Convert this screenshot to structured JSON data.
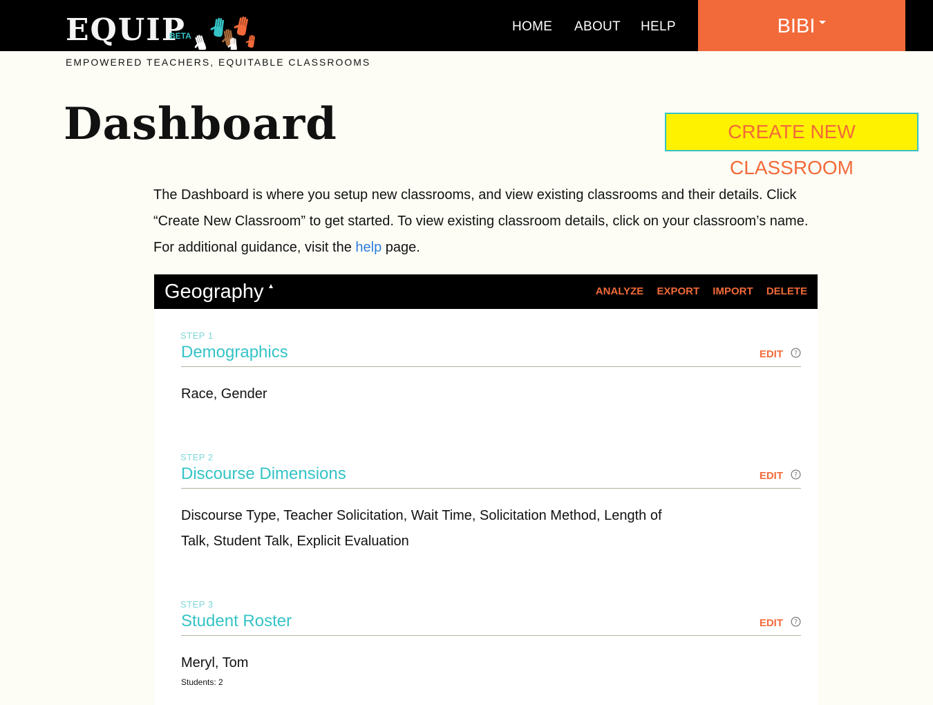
{
  "brand": {
    "name": "EQUIP",
    "badge": "BETA",
    "tagline": "EMPOWERED TEACHERS, EQUITABLE CLASSROOMS",
    "hand_colors": [
      "#ffffff",
      "#35c3c6",
      "#a86a3a",
      "#f26a3a",
      "#ffffff",
      "#f26a3a"
    ]
  },
  "nav": {
    "items": [
      "HOME",
      "ABOUT",
      "HELP"
    ],
    "user": "BIBI"
  },
  "page": {
    "title": "Dashboard",
    "create_button": "CREATE NEW CLASSROOM",
    "intro_before": "The Dashboard is where you setup new classrooms, and view existing classrooms and their details. Click “Create New Classroom” to get started. To view existing classroom details, click on your classroom’s name. For additional guidance, visit the",
    "intro_link": "help",
    "intro_after": "page."
  },
  "classroom": {
    "name": "Geography",
    "actions": [
      "ANALYZE",
      "EXPORT",
      "IMPORT",
      "DELETE"
    ],
    "edit_label": "EDIT",
    "steps": [
      {
        "label": "STEP 1",
        "title": "Demographics",
        "content": "Race, Gender"
      },
      {
        "label": "STEP 2",
        "title": "Discourse Dimensions",
        "content": "Discourse Type, Teacher Solicitation, Wait Time, Solicitation Method, Length of Talk, Student Talk, Explicit Evaluation"
      },
      {
        "label": "STEP 3",
        "title": "Student Roster",
        "content": "Meryl, Tom",
        "count": "Students: 2"
      }
    ]
  },
  "colors": {
    "accent_orange": "#f26a3a",
    "accent_teal": "#35c3c6",
    "button_yellow": "#fff200",
    "link_blue": "#2b7de1"
  }
}
